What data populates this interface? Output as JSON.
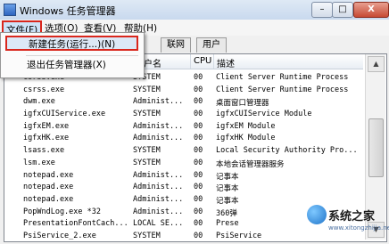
{
  "window": {
    "title": "Windows 任务管理器",
    "min_label": "–",
    "max_label": "□",
    "close_label": "X"
  },
  "menubar": {
    "file": "文件(F)",
    "options": "选项(O)",
    "view": "查看(V)",
    "help": "帮助(H)"
  },
  "file_menu": {
    "new_task": "新建任务(运行...)(N)",
    "exit": "退出任务管理器(X)"
  },
  "tabs": [
    "联网",
    "用户"
  ],
  "columns": {
    "user": "用户名",
    "cpu": "CPU",
    "desc": "描述"
  },
  "processes": [
    {
      "name": "csrss.exe",
      "user": "SYSTEM",
      "cpu": "00",
      "desc": "Client Server Runtime Process"
    },
    {
      "name": "csrss.exe",
      "user": "SYSTEM",
      "cpu": "00",
      "desc": "Client Server Runtime Process"
    },
    {
      "name": "dwm.exe",
      "user": "Administ...",
      "cpu": "00",
      "desc": "桌面窗口管理器"
    },
    {
      "name": "igfxCUIService.exe",
      "user": "SYSTEM",
      "cpu": "00",
      "desc": "igfxCUIService Module"
    },
    {
      "name": "igfxEM.exe",
      "user": "Administ...",
      "cpu": "00",
      "desc": "igfxEM Module"
    },
    {
      "name": "igfxHK.exe",
      "user": "Administ...",
      "cpu": "00",
      "desc": "igfxHK Module"
    },
    {
      "name": "lsass.exe",
      "user": "SYSTEM",
      "cpu": "00",
      "desc": "Local Security Authority Pro..."
    },
    {
      "name": "lsm.exe",
      "user": "SYSTEM",
      "cpu": "00",
      "desc": "本地会话管理器服务"
    },
    {
      "name": "notepad.exe",
      "user": "Administ...",
      "cpu": "00",
      "desc": "记事本"
    },
    {
      "name": "notepad.exe",
      "user": "Administ...",
      "cpu": "00",
      "desc": "记事本"
    },
    {
      "name": "notepad.exe",
      "user": "Administ...",
      "cpu": "00",
      "desc": "记事本"
    },
    {
      "name": "PopWndLog.exe *32",
      "user": "Administ...",
      "cpu": "00",
      "desc": "360弹"
    },
    {
      "name": "PresentationFontCach...",
      "user": "LOCAL SE...",
      "cpu": "00",
      "desc": "Prese"
    },
    {
      "name": "PsiService_2.exe",
      "user": "SYSTEM",
      "cpu": "00",
      "desc": "PsiService"
    }
  ],
  "watermark": {
    "text": "系统之家",
    "url": "www.xitongzhijia.net"
  }
}
